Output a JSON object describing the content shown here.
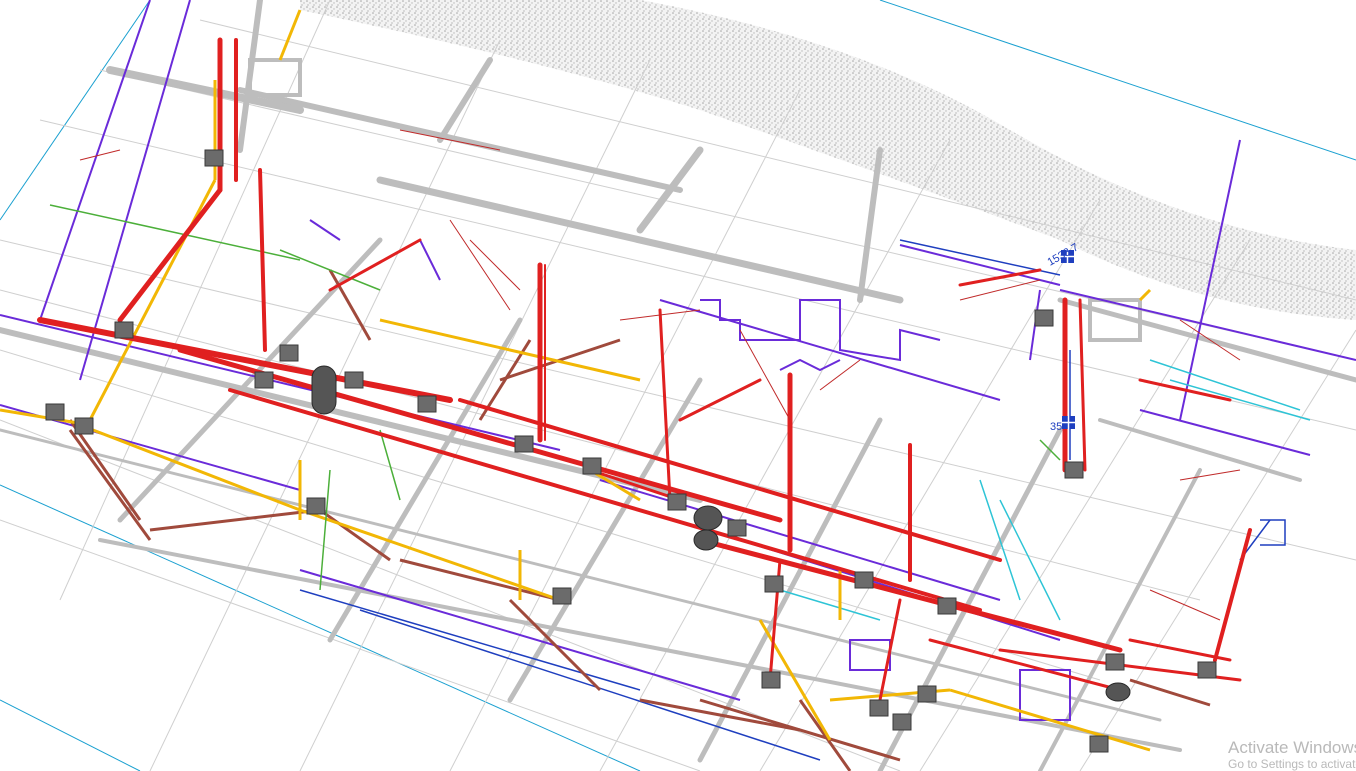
{
  "viewport": {
    "background": "#ffffff",
    "description_colors": {
      "fire_sprinkler_main": "#e02020",
      "ductwork": "#bdbdbd",
      "gas_yellow": "#f2b705",
      "electrical_purple": "#6a2bd9",
      "drainage_brown": "#a04a3c",
      "chilled_water_blue": "#1f3fbf",
      "condensate_cyan": "#2ec4d6",
      "misc_green": "#4caf3a",
      "slab_edge": "#1aa0d0",
      "pattern_gray": "#c8c8c8"
    }
  },
  "tags": {
    "elevation_upper": "1538.7",
    "elevation_lower": "35"
  },
  "watermark": {
    "title": "Activate Windows",
    "subtitle": "Go to Settings to activate Windows."
  }
}
